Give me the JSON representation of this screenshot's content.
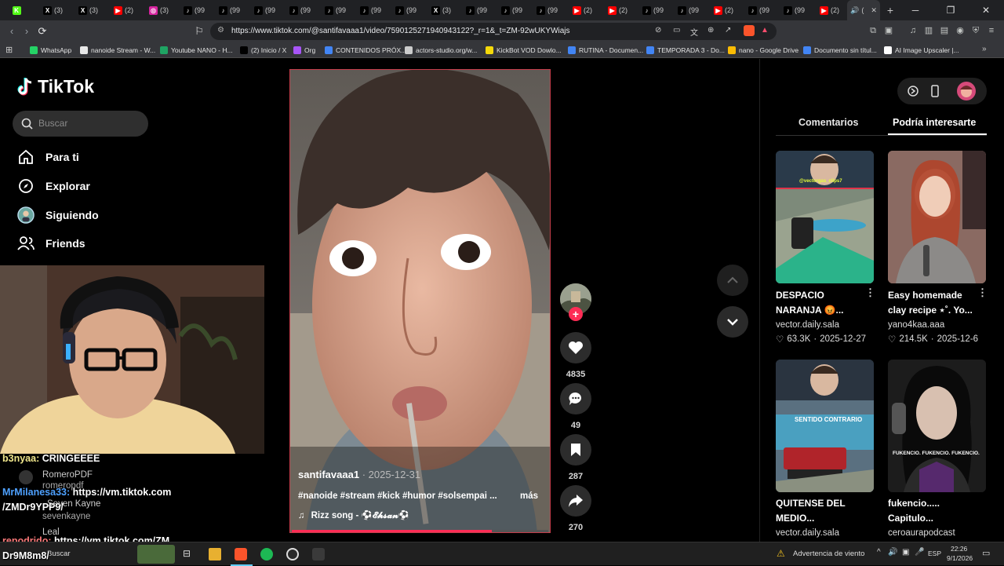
{
  "browser": {
    "tabs": [
      {
        "icon": "kick-icon",
        "label": "",
        "color": "#53fc18"
      },
      {
        "icon": "x-icon",
        "label": "(3)",
        "color": "#000000"
      },
      {
        "icon": "x-icon",
        "label": "(3)",
        "color": "#000000"
      },
      {
        "icon": "youtube-icon",
        "label": "(2)",
        "color": "#ff0000"
      },
      {
        "icon": "instagram-icon",
        "label": "(3)",
        "color": "#d6249f"
      },
      {
        "icon": "tiktok-icon",
        "label": "(99",
        "color": "#000000"
      },
      {
        "icon": "tiktok-icon",
        "label": "(99",
        "color": "#000000"
      },
      {
        "icon": "tiktok-icon",
        "label": "(99",
        "color": "#000000"
      },
      {
        "icon": "tiktok-icon",
        "label": "(99",
        "color": "#000000"
      },
      {
        "icon": "tiktok-icon",
        "label": "(99",
        "color": "#000000"
      },
      {
        "icon": "tiktok-icon",
        "label": "(99",
        "color": "#000000"
      },
      {
        "icon": "tiktok-icon",
        "label": "(99",
        "color": "#000000"
      },
      {
        "icon": "x-icon",
        "label": "(3)",
        "color": "#000000"
      },
      {
        "icon": "tiktok-icon",
        "label": "(99",
        "color": "#000000"
      },
      {
        "icon": "tiktok-icon",
        "label": "(99",
        "color": "#000000"
      },
      {
        "icon": "tiktok-icon",
        "label": "(99",
        "color": "#000000"
      },
      {
        "icon": "youtube-icon",
        "label": "(2)",
        "color": "#ff0000"
      },
      {
        "icon": "youtube-icon",
        "label": "(2)",
        "color": "#ff0000"
      },
      {
        "icon": "tiktok-icon",
        "label": "(99",
        "color": "#000000"
      },
      {
        "icon": "tiktok-icon",
        "label": "(99",
        "color": "#000000"
      },
      {
        "icon": "youtube-icon",
        "label": "(2)",
        "color": "#ff0000"
      },
      {
        "icon": "tiktok-icon",
        "label": "(99",
        "color": "#000000"
      },
      {
        "icon": "tiktok-icon",
        "label": "(99",
        "color": "#000000"
      },
      {
        "icon": "youtube-icon",
        "label": "(2)",
        "color": "#ff0000"
      }
    ],
    "active_tab_label": "(",
    "new_tab": "+",
    "url": "https://www.tiktok.com/@santifavaaa1/video/7590125271940943122?_r=1&_t=ZM-92wUKYWiajs",
    "bookmarks": [
      {
        "label": "WhatsApp",
        "color": "#25d366"
      },
      {
        "label": "nanoide Stream - W...",
        "color": "#e8e8e8"
      },
      {
        "label": "Youtube NANO - H...",
        "color": "#1fa463"
      },
      {
        "label": "(2) Inicio / X",
        "color": "#000000"
      },
      {
        "label": "Org",
        "color": "#a855f7"
      },
      {
        "label": "CONTENIDOS PRÓX...",
        "color": "#4285f4"
      },
      {
        "label": "actors-studio.org/w...",
        "color": "#cccccc"
      },
      {
        "label": "KickBot VOD Dowlo...",
        "color": "#f5d90a"
      },
      {
        "label": "RUTINA - Documen...",
        "color": "#4285f4"
      },
      {
        "label": "TEMPORADA 3 - Do...",
        "color": "#4285f4"
      },
      {
        "label": "nano - Google Drive",
        "color": "#fbbc04"
      },
      {
        "label": "Documento sin títul...",
        "color": "#4285f4"
      },
      {
        "label": "AI Image Upscaler |...",
        "color": "#ffffff"
      }
    ]
  },
  "tiktok": {
    "logo": "TikTok",
    "search_placeholder": "Buscar",
    "nav": [
      {
        "label": "Para ti",
        "icon": "home-icon"
      },
      {
        "label": "Explorar",
        "icon": "compass-icon"
      },
      {
        "label": "Siguiendo",
        "icon": "following-avatar-icon"
      },
      {
        "label": "Friends",
        "icon": "friends-icon"
      }
    ],
    "video": {
      "author": "santifavaaa1",
      "date": "2025-12-31",
      "hashtags": "#nanoide #stream #kick #humor #solsempai ...",
      "more": "más",
      "music": "Rizz song - ⚽𝓔𝓱𝓼𝓪𝓷⚽",
      "progress": 0.78
    },
    "actions": {
      "likes": "4835",
      "comments": "49",
      "saves": "287",
      "shares": "270"
    },
    "right_tabs": {
      "comments": "Comentarios",
      "suggested": "Podría interesarte"
    },
    "cards": [
      {
        "title1": "DESPACIO",
        "title2": "NARANJA 😡...",
        "author": "vector.daily.sala",
        "likes": "63.3K",
        "date": "2025-12-27",
        "thumb_text": "@vectorgas_clips7"
      },
      {
        "title1": "Easy homemade",
        "title2": "clay recipe ⋆˚. Yo...",
        "author": "yano4kaa.aaa",
        "likes": "214.5K",
        "date": "2025-12-6",
        "thumb_text": ""
      },
      {
        "title1": "QUITENSE DEL",
        "title2": "MEDIO...",
        "author": "vector.daily.sala",
        "likes": "",
        "date": "",
        "thumb_text": "SENTIDO CONTRARIO"
      },
      {
        "title1": "fukencio.....",
        "title2": "Capitulo...",
        "author": "ceroaurapodcast",
        "likes": "",
        "date": "",
        "thumb_text": "FUKENCIO. FUKENCIO. FUKENCIO."
      }
    ]
  },
  "stream_chat": [
    {
      "user": "b3nyaa:",
      "msg": " CRINGEEEE",
      "user_color": "#f0e68c"
    },
    {
      "user": "RomeroPDF",
      "msg": "",
      "user_color": "#cccccc"
    },
    {
      "user": "romeropdf",
      "msg": "",
      "user_color": "#cccccc"
    },
    {
      "user": "MrMilanesa33:",
      "msg": " https://vm.tiktok.com",
      "user_color": "#4ea1ff"
    },
    {
      "user": "",
      "msg": "/ZMDr9YPP9/",
      "user_color": "#ffffff"
    },
    {
      "user": "Seven Kayne",
      "msg": "",
      "user_color": "#cccccc"
    },
    {
      "user": "sevenkayne",
      "msg": "",
      "user_color": "#cccccc"
    },
    {
      "user": "Leal",
      "msg": "",
      "user_color": "#cccccc"
    },
    {
      "user": "repodrido:",
      "msg": " https://vm.tiktok.com/ZM",
      "user_color": "#ff7a7a"
    },
    {
      "user": "",
      "msg": "Dr9M8m8/",
      "user_color": "#ffffff"
    }
  ],
  "taskbar": {
    "search": "Buscar",
    "weather": "Advertencia de viento",
    "lang": "ESP",
    "time": "22:26",
    "date": "9/1/2026"
  }
}
